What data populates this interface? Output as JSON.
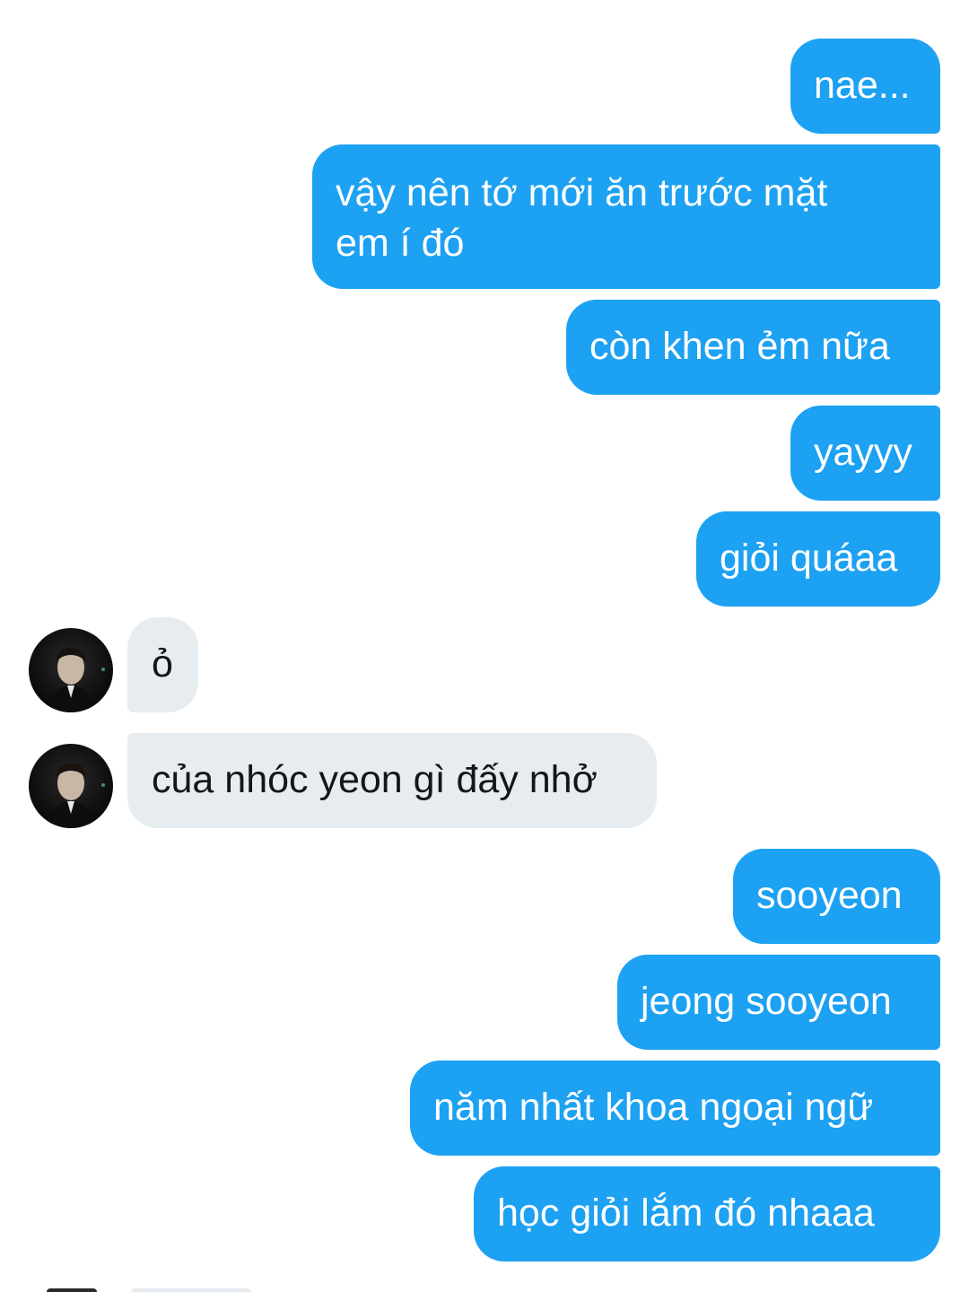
{
  "conversation": {
    "messages": [
      {
        "direction": "sent",
        "text": "nae..."
      },
      {
        "direction": "sent",
        "text": "vậy nên tớ mới ăn trước mặt em í đó"
      },
      {
        "direction": "sent",
        "text": "còn khen ẻm nữa"
      },
      {
        "direction": "sent",
        "text": "yayyy"
      },
      {
        "direction": "sent",
        "text": "giỏi quáaa"
      },
      {
        "direction": "received",
        "text": "ỏ"
      },
      {
        "direction": "received",
        "text": "của nhóc yeon gì đấy nhở"
      },
      {
        "direction": "sent",
        "text": "sooyeon"
      },
      {
        "direction": "sent",
        "text": "jeong sooyeon"
      },
      {
        "direction": "sent",
        "text": "năm nhất khoa ngoại ngữ"
      },
      {
        "direction": "sent",
        "text": "học giỏi lắm đó nhaaa"
      }
    ]
  },
  "avatar": {
    "icon": "contact-avatar-icon"
  },
  "colors": {
    "sent_bubble": "#1da1f2",
    "received_bubble": "#e6ecf0",
    "sent_text": "#ffffff",
    "received_text": "#14171a",
    "background": "#ffffff"
  }
}
